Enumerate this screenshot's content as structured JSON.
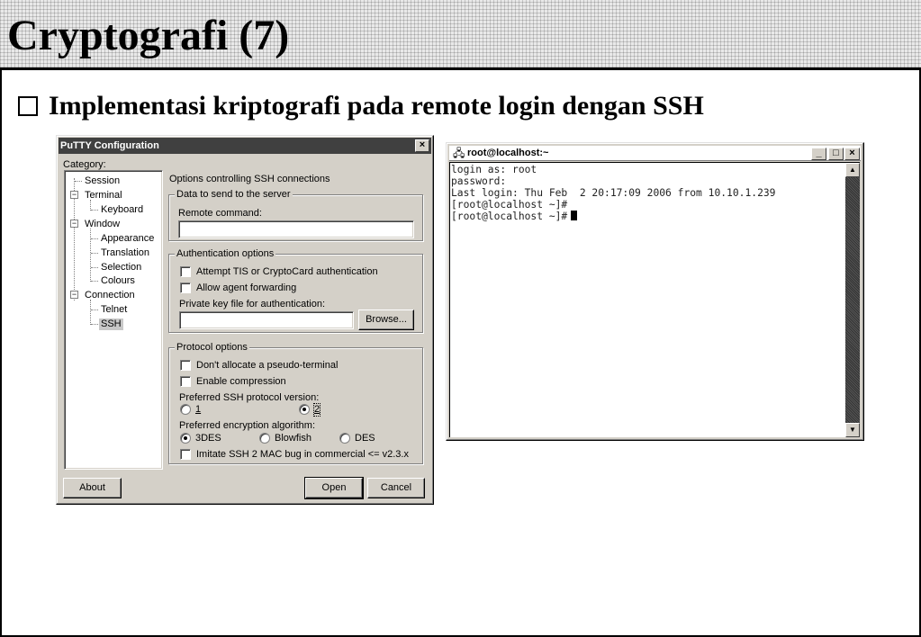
{
  "slide": {
    "title": "Cryptografi (7)",
    "bullet": "Implementasi kriptografi pada remote login dengan SSH"
  },
  "putty": {
    "window_title": "PuTTY Configuration",
    "close_glyph": "×",
    "category_label": "Category:",
    "tree": {
      "session": "Session",
      "terminal": "Terminal",
      "keyboard": "Keyboard",
      "window": "Window",
      "appearance": "Appearance",
      "translation": "Translation",
      "selection": "Selection",
      "colours": "Colours",
      "connection": "Connection",
      "telnet": "Telnet",
      "ssh": "SSH"
    },
    "panel_heading": "Options controlling SSH connections",
    "data_group": {
      "title": "Data to send to the server",
      "remote_command_label": "Remote command:",
      "remote_command_value": ""
    },
    "auth_group": {
      "title": "Authentication options",
      "tis_label": "Attempt TIS or CryptoCard authentication",
      "agent_label": "Allow agent forwarding",
      "keyfile_label": "Private key file for authentication:",
      "keyfile_value": "",
      "browse_label": "Browse..."
    },
    "protocol_group": {
      "title": "Protocol options",
      "no_pty_label": "Don't allocate a pseudo-terminal",
      "compression_label": "Enable compression",
      "version_label": "Preferred SSH protocol version:",
      "version_options": [
        "1",
        "2"
      ],
      "version_selected": "2",
      "cipher_label": "Preferred encryption algorithm:",
      "cipher_options": [
        "3DES",
        "Blowfish",
        "DES"
      ],
      "cipher_selected": "3DES",
      "mac_bug_label": "Imitate SSH 2 MAC bug in commercial <= v2.3.x"
    },
    "buttons": {
      "about": "About",
      "open": "Open",
      "cancel": "Cancel"
    }
  },
  "terminal": {
    "window_title": "root@localhost:~",
    "title_icon": "computer-icon",
    "lines": [
      "login as: root",
      "password:",
      "Last login: Thu Feb  2 20:17:09 2006 from 10.10.1.239",
      "[root@localhost ~]#",
      "[root@localhost ~]#"
    ]
  }
}
